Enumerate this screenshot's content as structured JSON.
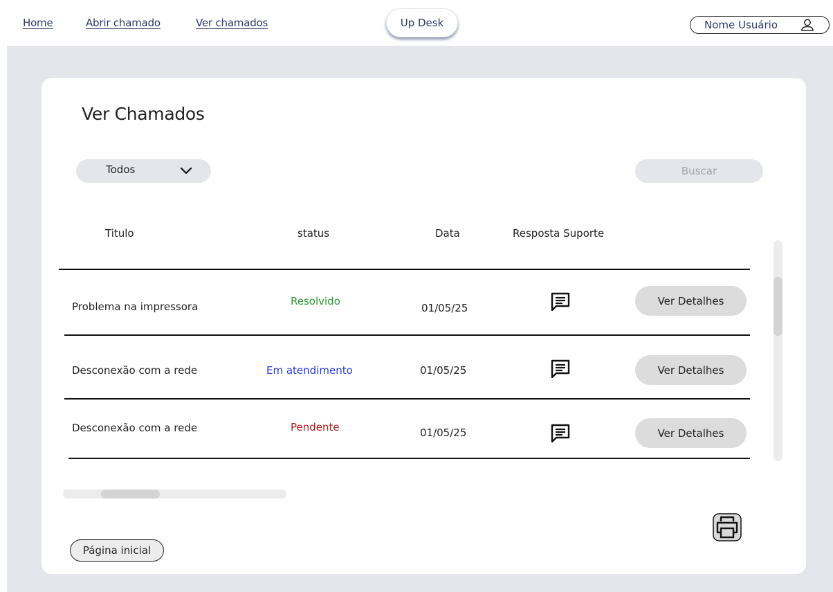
{
  "nav": {
    "links": [
      "Home",
      "Abrir chamado",
      "Ver chamados"
    ],
    "brand": "Up Desk",
    "user_name": "Nome Usuário"
  },
  "page": {
    "title": "Ver Chamados",
    "filter_value": "Todos",
    "search_placeholder": "Buscar"
  },
  "table": {
    "headers": [
      "Titulo",
      "status",
      "Data",
      "Resposta Suporte"
    ],
    "rows": [
      {
        "title": "Problema na impressora",
        "status": "Resolvido",
        "date": "01/05/25",
        "action": "Ver Detalhes",
        "status_color": "#2e9a2e"
      },
      {
        "title": "Desconexão com a rede",
        "status": "Em atendimento",
        "date": "01/05/25",
        "action": "Ver Detalhes",
        "status_color": "#2a3bd4"
      },
      {
        "title": "Desconexão com a rede",
        "status": "Pendente",
        "date": "01/05/25",
        "action": "Ver Detalhes",
        "status_color": "#b81c1c"
      }
    ]
  },
  "footer": {
    "home_button": "Página inicial"
  },
  "icons": {
    "response": "chat-message-icon",
    "print": "printer-icon",
    "user": "user-icon",
    "filter": "chevron-down-icon"
  }
}
